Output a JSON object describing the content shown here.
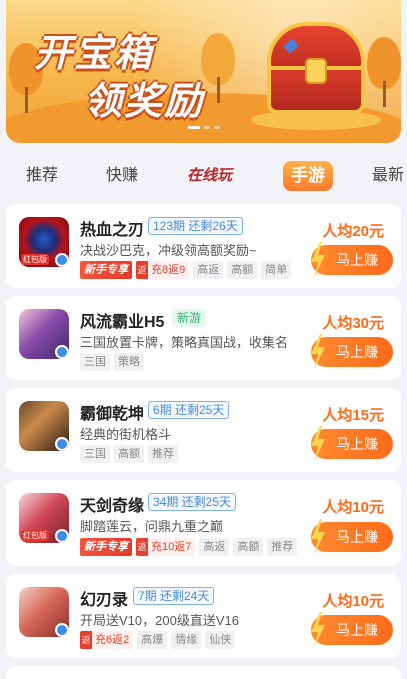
{
  "banner": {
    "title_line1": "开宝箱",
    "title_line2": "领奖励"
  },
  "tabs": [
    {
      "label": "推荐",
      "active": false
    },
    {
      "label": "快赚",
      "active": false
    },
    {
      "label": "在线玩",
      "active": false
    },
    {
      "label": "手游",
      "active": true
    },
    {
      "label": "最新",
      "active": false
    }
  ],
  "games": [
    {
      "name": "热血之刃",
      "period": "123期  还剩26天",
      "desc": "决战沙巴克，冲级领高额奖励~",
      "icon_badge": "红包版",
      "price": "人均20元",
      "button": "马上赚",
      "tags": [
        {
          "text": "新手专享",
          "kind": "red"
        },
        {
          "text": "充8返9",
          "kind": "ret",
          "q": "返"
        },
        {
          "text": "高返",
          "kind": "plain"
        },
        {
          "text": "高额",
          "kind": "plain"
        },
        {
          "text": "简单",
          "kind": "plain"
        }
      ]
    },
    {
      "name": "风流霸业H5",
      "newtag": "新游",
      "desc": "三国放置卡牌，策略真国战，收集名",
      "price": "人均30元",
      "button": "马上赚",
      "tags": [
        {
          "text": "三国",
          "kind": "plain"
        },
        {
          "text": "策略",
          "kind": "plain"
        }
      ]
    },
    {
      "name": "霸御乾坤",
      "period": "6期  还剩25天",
      "desc": "经典的街机格斗",
      "price": "人均15元",
      "button": "马上赚",
      "tags": [
        {
          "text": "三国",
          "kind": "plain"
        },
        {
          "text": "高额",
          "kind": "plain"
        },
        {
          "text": "推荐",
          "kind": "plain"
        }
      ]
    },
    {
      "name": "天剑奇缘",
      "period": "34期  还剩25天",
      "desc": "脚踏莲云，问鼎九重之巅",
      "icon_badge": "红包版",
      "price": "人均10元",
      "button": "马上赚",
      "tags": [
        {
          "text": "新手专享",
          "kind": "red"
        },
        {
          "text": "充10返7",
          "kind": "ret",
          "q": "返"
        },
        {
          "text": "高返",
          "kind": "plain"
        },
        {
          "text": "高额",
          "kind": "plain"
        },
        {
          "text": "推荐",
          "kind": "plain"
        }
      ]
    },
    {
      "name": "幻刃录",
      "period": "7期  还剩24天",
      "desc": "开局送V10，200级直送V16",
      "price": "人均10元",
      "button": "马上赚",
      "tags": [
        {
          "text": "充6返2",
          "kind": "ret",
          "q": "返"
        },
        {
          "text": "高爆",
          "kind": "plain"
        },
        {
          "text": "情缘",
          "kind": "plain"
        },
        {
          "text": "仙侠",
          "kind": "plain"
        }
      ]
    }
  ],
  "colors": {
    "accent": "#ff6a1a",
    "period_blue": "#4a8bd6",
    "new_green": "#2fb36b",
    "tag_red": "#e3402f"
  }
}
